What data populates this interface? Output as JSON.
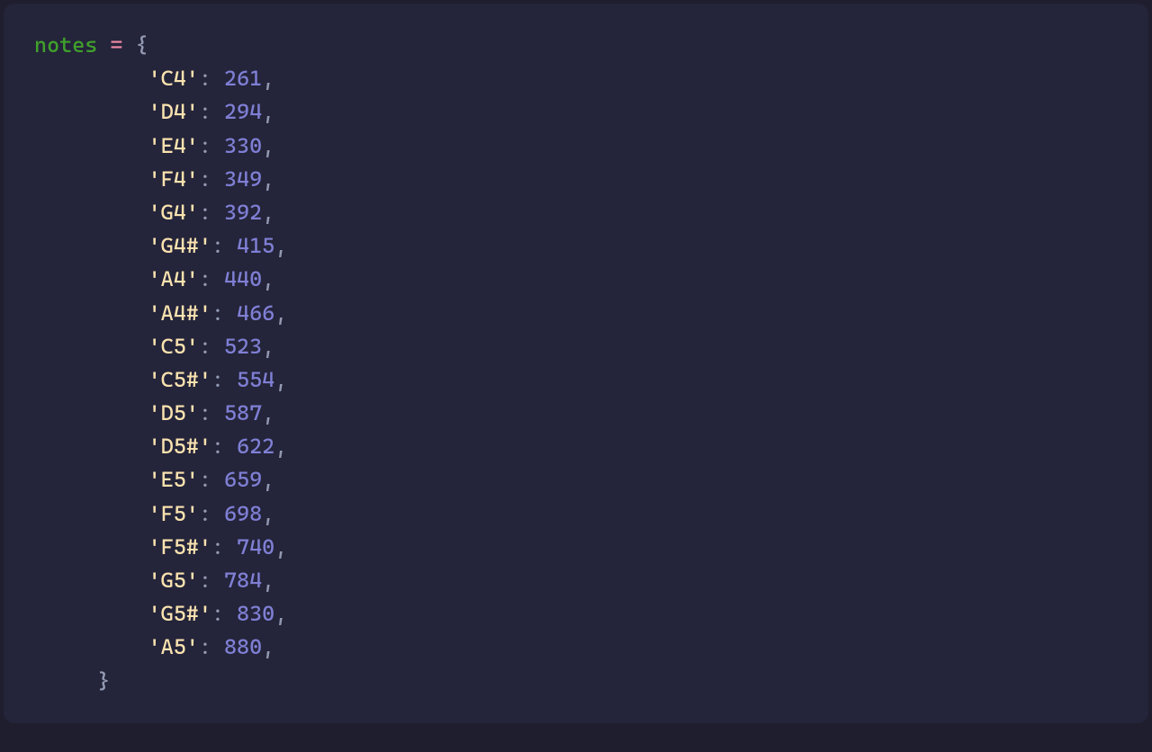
{
  "code": {
    "varName": "notes",
    "assignOp": "=",
    "openBrace": "{",
    "closeBrace": "}",
    "colon": ":",
    "comma": ","
  },
  "notes": [
    {
      "key": "'C4'",
      "value": "261"
    },
    {
      "key": "'D4'",
      "value": "294"
    },
    {
      "key": "'E4'",
      "value": "330"
    },
    {
      "key": "'F4'",
      "value": "349"
    },
    {
      "key": "'G4'",
      "value": "392"
    },
    {
      "key": "'G4#'",
      "value": "415"
    },
    {
      "key": "'A4'",
      "value": "440"
    },
    {
      "key": "'A4#'",
      "value": "466"
    },
    {
      "key": "'C5'",
      "value": "523"
    },
    {
      "key": "'C5#'",
      "value": "554"
    },
    {
      "key": "'D5'",
      "value": "587"
    },
    {
      "key": "'D5#'",
      "value": "622"
    },
    {
      "key": "'E5'",
      "value": "659"
    },
    {
      "key": "'F5'",
      "value": "698"
    },
    {
      "key": "'F5#'",
      "value": "740"
    },
    {
      "key": "'G5'",
      "value": "784"
    },
    {
      "key": "'G5#'",
      "value": "830"
    },
    {
      "key": "'A5'",
      "value": "880"
    }
  ],
  "indent": {
    "entry": "         ",
    "close": "     "
  },
  "space": " "
}
